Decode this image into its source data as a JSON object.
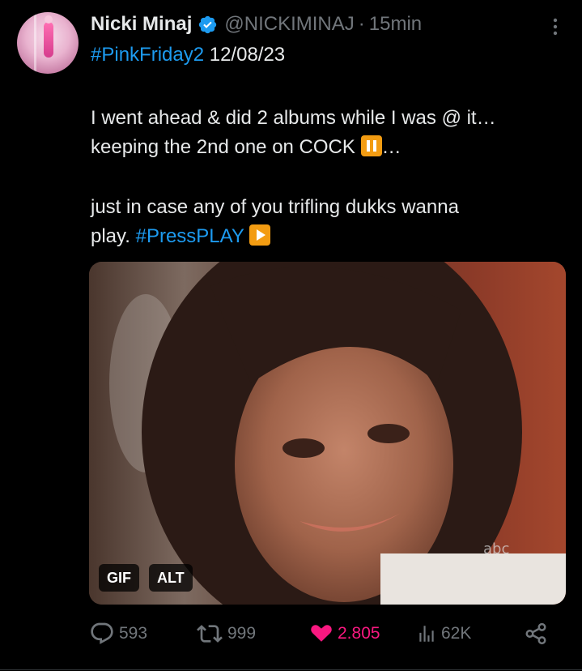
{
  "tweet": {
    "display_name": "Nicki Minaj",
    "handle": "@NICKIMINAJ",
    "separator": "·",
    "timestamp": "15min",
    "text": {
      "hashtag_1": "#PinkFriday2",
      "date": " 12/08/23",
      "line_2": "I went ahead & did 2 albums while I was @ it…",
      "line_3_start": "keeping the 2nd one on COCK ",
      "line_3_end": "…",
      "line_4": "just in case any of you trifling dukks wanna",
      "line_5_start": "play. ",
      "hashtag_2": "#PressPLAY"
    },
    "media": {
      "gif_badge": "GIF",
      "alt_badge": "ALT",
      "watermark": "abc"
    },
    "actions": {
      "replies": "593",
      "reposts": "999",
      "likes": "2.805",
      "views": "62K"
    }
  },
  "icons": {
    "verified": "verified-badge-icon",
    "more": "more-options-icon",
    "reply": "reply-icon",
    "repost": "repost-icon",
    "like": "heart-icon",
    "views": "views-icon",
    "share": "share-icon",
    "pause_emoji": "pause-emoji-icon",
    "play_emoji": "play-emoji-icon"
  },
  "colors": {
    "background": "#000000",
    "text": "#e7e9ea",
    "secondary_text": "#71767b",
    "link": "#1d9bf0",
    "verified": "#1d9bf0",
    "like": "#f91880",
    "emoji_box": "#f39c12"
  }
}
